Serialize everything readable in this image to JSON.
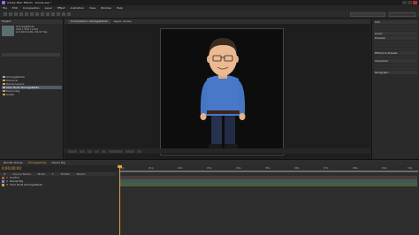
{
  "title": "Adobe After Effects - Daniel.aep *",
  "menu": [
    "File",
    "Edit",
    "Composition",
    "Layer",
    "Effect",
    "Animation",
    "View",
    "Window",
    "Help"
  ],
  "project": {
    "tab": "Project",
    "comp_name": "Ahmegabbide",
    "comp_info1": "400 x 400 (1.00)",
    "comp_info2": "Δ 0;00;10;00, 29.97 fps",
    "items": [
      {
        "label": "Ahmegabbide",
        "type": "comp"
      },
      {
        "label": "Daniel.ai",
        "type": "footage"
      },
      {
        "label": "Daniel Layers",
        "type": "folder"
      },
      {
        "label": "Char Rods Ahmegabbide",
        "type": "folder",
        "selected": true
      },
      {
        "label": "Daniel Rig",
        "type": "folder"
      },
      {
        "label": "Solids",
        "type": "folder"
      }
    ]
  },
  "composition": {
    "tabs": [
      "Composition: Ahmegabbide",
      "Layer: (none)"
    ],
    "view_label": "Active Camera",
    "zoom": "50%",
    "view_count": "1 View"
  },
  "right_panel": {
    "sections": [
      "Info",
      "Audio",
      "Preview",
      "Effects & Presets",
      "Character",
      "Paragraph"
    ]
  },
  "timeline": {
    "tabs": [
      "Render Queue",
      "Ahmegabbide",
      "Daniel Rig"
    ],
    "active_tab": "Ahmegabbide",
    "timecode": "0;00;00;00",
    "columns": [
      "#",
      "Source Name",
      "Mode",
      "T",
      "TrkMat",
      "Parent"
    ],
    "layers": [
      {
        "num": "1",
        "name": "Control",
        "color": "r"
      },
      {
        "num": "2",
        "name": "Daniel Rig",
        "color": "b"
      },
      {
        "num": "3",
        "name": "Char Rods Ahmegabbide",
        "color": "y"
      }
    ],
    "ruler_ticks": [
      "00s",
      "01s",
      "02s",
      "03s",
      "04s",
      "05s",
      "06s",
      "07s",
      "08s",
      "09s",
      "10s"
    ]
  },
  "colors": {
    "accent": "#e0a13a",
    "shirt": "#4a78c9",
    "jeans": "#27324e",
    "bar_green": "#4a5e3c",
    "bar_teal": "#3c5a5a"
  }
}
